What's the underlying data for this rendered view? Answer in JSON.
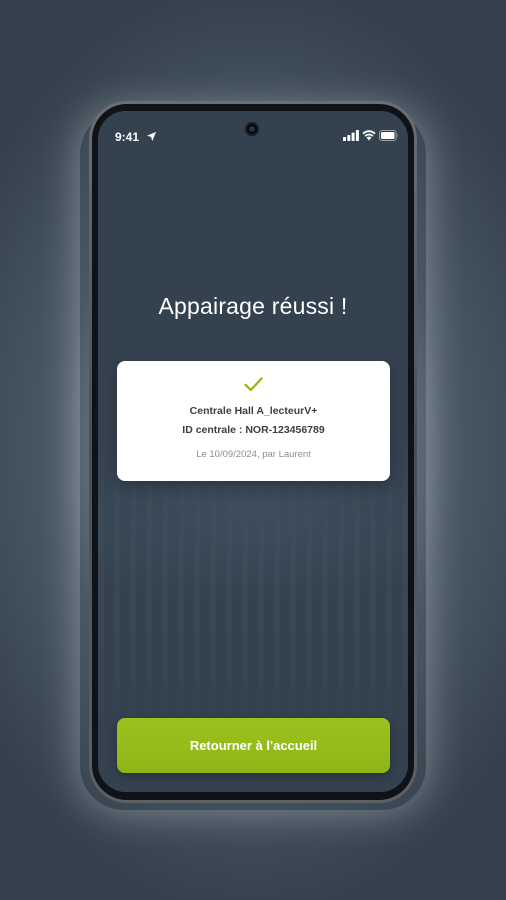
{
  "status_bar": {
    "time": "9:41",
    "icons": [
      "location-arrow-icon",
      "cellular-signal-icon",
      "wifi-icon",
      "battery-icon"
    ]
  },
  "main": {
    "title": "Appairage réussi !"
  },
  "card": {
    "icon": "checkmark-icon",
    "device_name": "Centrale Hall A_lecteurV+",
    "central_id": "ID centrale : NOR-123456789",
    "paired_info": "Le 10/09/2024, par Laurent"
  },
  "actions": {
    "home_button_label": "Retourner à l'accueil"
  },
  "colors": {
    "screen_background": "#344250",
    "accent_green": "#94bd1a",
    "check_green": "#8db616",
    "card_background": "#ffffff"
  }
}
